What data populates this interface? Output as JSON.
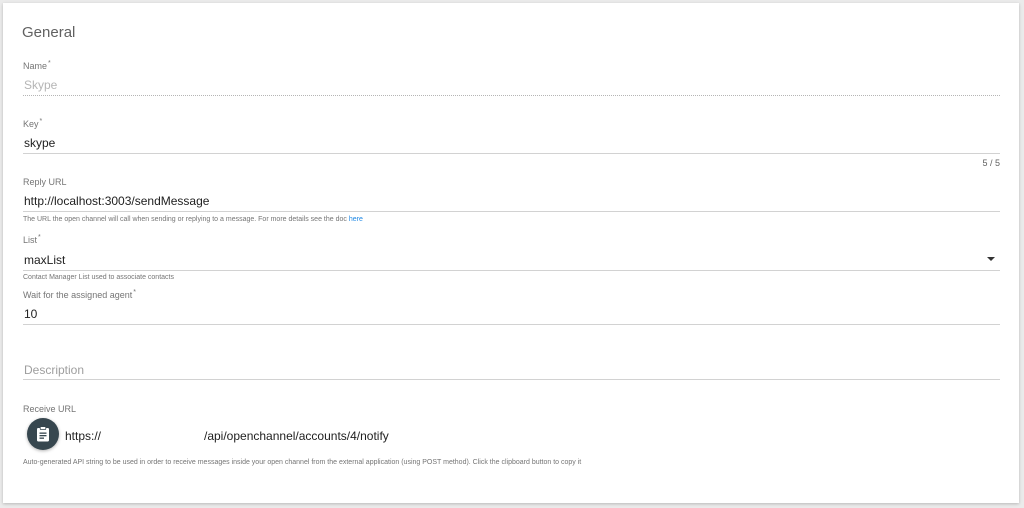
{
  "section": {
    "title": "General"
  },
  "name_field": {
    "label": "Name",
    "required_mark": "*",
    "value": "Skype"
  },
  "key_field": {
    "label": "Key",
    "required_mark": "*",
    "value": "skype",
    "counter": "5 / 5"
  },
  "reply_url_field": {
    "label": "Reply URL",
    "value": "http://localhost:3003/sendMessage",
    "hint": "The URL the open channel will call when sending or replying to a message. For more details see the doc",
    "hint_link": "here"
  },
  "list_field": {
    "label": "List",
    "required_mark": "*",
    "value": "maxList",
    "hint": "Contact Manager List used to associate contacts"
  },
  "wait_field": {
    "label": "Wait for the assigned agent",
    "required_mark": "*",
    "value": "10"
  },
  "description_field": {
    "placeholder": "Description"
  },
  "receive_url": {
    "label": "Receive URL",
    "prefix": "https://",
    "suffix": "/api/openchannel/accounts/4/notify",
    "hint": "Auto-generated API string to be used in order to receive messages inside your open channel from the external application (using POST method). Click the clipboard button to copy it",
    "copy_icon": "clipboard-icon"
  },
  "colors": {
    "label": "#757575",
    "text": "#212121",
    "disabled_text": "#b5b5b5",
    "link": "#1e88e5",
    "copy_button": "#37474f"
  }
}
